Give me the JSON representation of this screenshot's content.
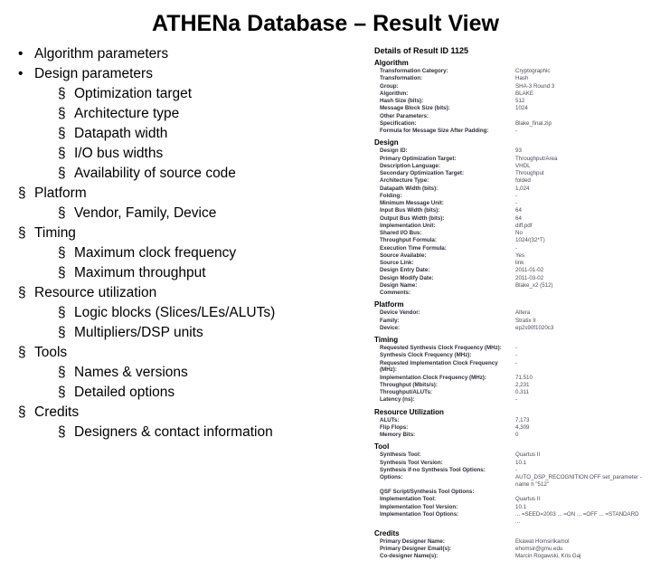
{
  "title": "ATHENa Database – Result View",
  "outline": [
    {
      "bullet": "disc",
      "label": "Algorithm parameters"
    },
    {
      "bullet": "disc",
      "label": "Design parameters",
      "children": [
        "Optimization target",
        "Architecture type",
        "Datapath width",
        "I/O bus widths",
        "Availability of source code"
      ]
    },
    {
      "bullet": "sq",
      "label": "Platform",
      "children": [
        "Vendor, Family, Device"
      ]
    },
    {
      "bullet": "sq",
      "label": "Timing",
      "children": [
        "Maximum clock frequency",
        "Maximum throughput"
      ]
    },
    {
      "bullet": "sq",
      "label": "Resource utilization",
      "children": [
        "Logic blocks (Slices/LEs/ALUTs)",
        "Multipliers/DSP units"
      ]
    },
    {
      "bullet": "sq",
      "label": "Tools",
      "children": [
        "Names & versions",
        "Detailed options"
      ]
    },
    {
      "bullet": "sq",
      "label": "Credits",
      "children": [
        "Designers & contact information"
      ]
    }
  ],
  "details": {
    "header": "Details of Result ID 1125",
    "sections": [
      {
        "title": "Algorithm",
        "rows": [
          [
            "Transformation Category:",
            "Cryptographic"
          ],
          [
            "Transformation:",
            "Hash"
          ],
          [
            "Group:",
            "SHA-3 Round 3"
          ],
          [
            "Algorithm:",
            "BLAKE"
          ],
          [
            "Hash Size (bits):",
            "512"
          ],
          [
            "Message Block Size (bits):",
            "1024"
          ],
          [
            "Other Parameters:",
            ""
          ],
          [
            "Specification:",
            "Blake_final.zip"
          ],
          [
            "Formula for Message Size After Padding:",
            "-"
          ]
        ]
      },
      {
        "title": "Design",
        "rows": [
          [
            "Design ID:",
            "93"
          ],
          [
            "Primary Optimization Target:",
            "Throughput/Area"
          ],
          [
            "Description Language:",
            "VHDL"
          ],
          [
            "Secondary Optimization Target:",
            "Throughput"
          ],
          [
            "Architecture Type:",
            "folded"
          ],
          [
            "Datapath Width (bits):",
            "1,024"
          ],
          [
            "Folding:",
            "-"
          ],
          [
            "Minimum Message Unit:",
            "-"
          ],
          [
            "Input Bus Width (bits):",
            "64"
          ],
          [
            "Output Bus Width (bits):",
            "64"
          ],
          [
            "Implementation Unit:",
            "diff.pdf"
          ],
          [
            "Shared I/O Bus:",
            "No"
          ],
          [
            "Throughput Formula:",
            "1024/(32*T)"
          ],
          [
            "Execution Time Formula:",
            "-"
          ],
          [
            "Source Available:",
            "Yes"
          ],
          [
            "Source Link:",
            "link"
          ],
          [
            "Design Entry Date:",
            "2011-01-02"
          ],
          [
            "Design Modify Date:",
            "2011-03-02"
          ],
          [
            "Design Name:",
            "Blake_x2 (512)"
          ],
          [
            "Comments:",
            ""
          ]
        ]
      },
      {
        "title": "Platform",
        "rows": [
          [
            "Device Vendor:",
            "Altera"
          ],
          [
            "Family:",
            "Stratix II"
          ],
          [
            "Device:",
            "ep2s90f1020c3"
          ]
        ]
      },
      {
        "title": "Timing",
        "rows": [
          [
            "Requested Synthesis Clock Frequency (MHz):",
            "-"
          ],
          [
            "Synthesis Clock Frequency (MHz):",
            "-"
          ],
          [
            "Requested Implementation Clock Frequency (MHz):",
            "-"
          ],
          [
            "Implementation Clock Frequency (MHz):",
            "71.510"
          ],
          [
            "Throughput (Mbits/s):",
            "2,231"
          ],
          [
            "Throughput/ALUTs:",
            "0.311"
          ],
          [
            "Latency (ns):",
            "-"
          ]
        ]
      },
      {
        "title": "Resource Utilization",
        "rows": [
          [
            "ALUTs:",
            "7,173"
          ],
          [
            "Flip Flops:",
            "4,309"
          ],
          [
            "Memory Bits:",
            "0"
          ]
        ]
      },
      {
        "title": "Tool",
        "rows": [
          [
            "Synthesis Tool:",
            "Quartus II"
          ],
          [
            "Synthesis Tool Version:",
            "10.1"
          ],
          [
            "Synthesis if-no Synthesis Tool Options:",
            "-"
          ],
          [
            "Options:",
            "AUTO_DSP_RECOGNITION OFF set_parameter -name h \"512\""
          ],
          [
            "QSF Script/Synthesis Tool Options:",
            ""
          ],
          [
            "Implementation Tool:",
            "Quartus II"
          ],
          [
            "Implementation Tool Version:",
            "10.1"
          ],
          [
            "Implementation Tool Options:",
            "... =SEED=2003 ... =ON ... =OFF ... =STANDARD ..."
          ]
        ]
      },
      {
        "title": "Credits",
        "rows": [
          [
            "Primary Designer Name:",
            "Ekawat Homsirikamol"
          ],
          [
            "Primary Designer Email(s):",
            "ehomsir@gmu.edu"
          ],
          [
            "Co-designer Name(s):",
            "Marcin Rogawski, Kris Gaj"
          ]
        ]
      }
    ]
  }
}
